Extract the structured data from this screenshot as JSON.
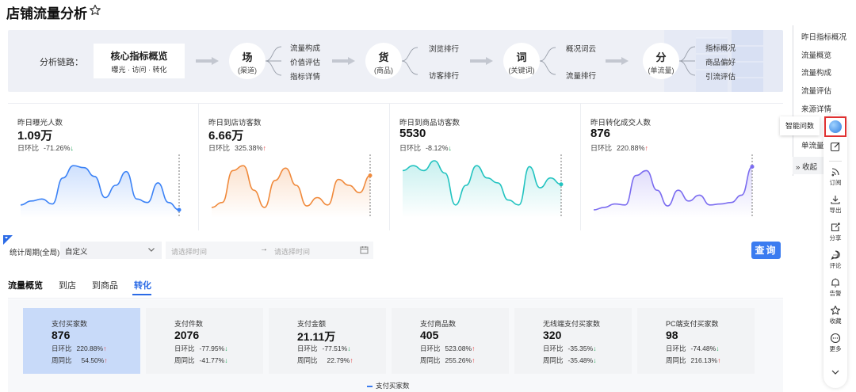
{
  "page": {
    "title": "店铺流量分析",
    "star_icon": "star-icon"
  },
  "chain": {
    "label": "分析链路：",
    "core": {
      "title": "核心指标概览",
      "sub": "曝光 · 访问 · 转化"
    },
    "nodes": [
      {
        "main": "场",
        "sub": "(渠道)",
        "items": [
          "流量构成",
          "价值评估",
          "指标详情"
        ]
      },
      {
        "main": "货",
        "sub": "(商品)",
        "items": [
          "浏览排行",
          "访客排行"
        ]
      },
      {
        "main": "词",
        "sub": "(关键词)",
        "items": [
          "概况词云",
          "流量排行"
        ]
      },
      {
        "main": "分",
        "sub": "(单流量)",
        "items": [
          "指标概况",
          "商品偏好",
          "引流评估"
        ]
      }
    ]
  },
  "metrics": [
    {
      "label": "昨日曝光人数",
      "value": "1.09万",
      "change_label": "日环比",
      "change": "-71.26%",
      "dir": "down",
      "color": "#3b82f6"
    },
    {
      "label": "昨日到店访客数",
      "value": "6.66万",
      "change_label": "日环比",
      "change": "325.38%",
      "dir": "up",
      "color": "#f08a3c"
    },
    {
      "label": "昨日到商品访客数",
      "value": "5530",
      "change_label": "日环比",
      "change": "-8.12%",
      "dir": "down",
      "color": "#22c3c0"
    },
    {
      "label": "昨日转化成交人数",
      "value": "876",
      "change_label": "日环比",
      "change": "220.88%",
      "dir": "up",
      "color": "#7b6cf0"
    }
  ],
  "filter": {
    "period_label": "统计周期(全局)",
    "period_value": "自定义",
    "start_placeholder": "请选择时间",
    "end_placeholder": "请选择时间",
    "query": "查询"
  },
  "tabs": [
    {
      "label": "流量概览",
      "state": "bold"
    },
    {
      "label": "到店",
      "state": ""
    },
    {
      "label": "到商品",
      "state": ""
    },
    {
      "label": "转化",
      "state": "active"
    }
  ],
  "kpis": [
    {
      "label": "支付买家数",
      "value": "876",
      "r1_label": "日环比",
      "r1": "220.88%",
      "r1_dir": "up",
      "r2_label": "周同比",
      "r2": "54.50%",
      "r2_dir": "up",
      "selected": true
    },
    {
      "label": "支付件数",
      "value": "2076",
      "r1_label": "日环比",
      "r1": "-77.95%",
      "r1_dir": "down",
      "r2_label": "周同比",
      "r2": "-41.77%",
      "r2_dir": "down"
    },
    {
      "label": "支付金额",
      "value": "21.11万",
      "r1_label": "日环比",
      "r1": "-77.51%",
      "r1_dir": "down",
      "r2_label": "周同比",
      "r2": "22.79%",
      "r2_dir": "up"
    },
    {
      "label": "支付商品数",
      "value": "405",
      "r1_label": "日环比",
      "r1": "523.08%",
      "r1_dir": "up",
      "r2_label": "周同比",
      "r2": "255.26%",
      "r2_dir": "up"
    },
    {
      "label": "无线端支付买家数",
      "value": "320",
      "r1_label": "日环比",
      "r1": "-35.35%",
      "r1_dir": "down",
      "r2_label": "周同比",
      "r2": "-35.48%",
      "r2_dir": "down"
    },
    {
      "label": "PC端支付买家数",
      "value": "98",
      "r1_label": "日环比",
      "r1": "-74.48%",
      "r1_dir": "down",
      "r2_label": "周同比",
      "r2": "216.13%",
      "r2_dir": "up"
    }
  ],
  "legend": "支付买家数",
  "right_nav": [
    "昨日指标概况",
    "流量概览",
    "流量构成",
    "流量评估",
    "来源详情",
    "单流量分析"
  ],
  "collapse": "收起",
  "toolbar": {
    "tooltip": "智能问数",
    "items": [
      "订阅",
      "导出",
      "分享",
      "评论",
      "告警",
      "收藏",
      "更多"
    ]
  }
}
